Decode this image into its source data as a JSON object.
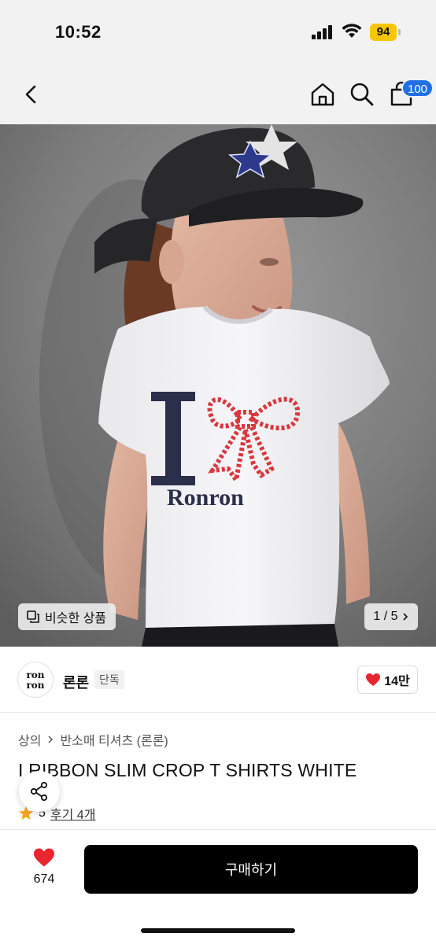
{
  "status_bar": {
    "time": "10:52",
    "battery": "94",
    "icons": [
      "signal-icon",
      "wifi-icon",
      "battery-icon"
    ]
  },
  "nav": {
    "icons": [
      "back-icon",
      "home-icon",
      "search-icon",
      "cart-icon"
    ],
    "cart_badge": "100"
  },
  "hero": {
    "similar_label": "비슷한 상품",
    "pager": "1 / 5",
    "shirt_print": {
      "letter": "I",
      "word": "Ronron"
    }
  },
  "brand": {
    "logo_lines": [
      "ron",
      "ron"
    ],
    "name": "론론",
    "tag": "단독",
    "likes": "14만"
  },
  "product": {
    "breadcrumb": [
      "상의",
      "반소매 티셔츠 (론론)"
    ],
    "title": "I RIBBON SLIM CROP T SHIRTS WHITE",
    "rating": "5",
    "reviews": "후기 4개"
  },
  "bottom_bar": {
    "wish_count": "674",
    "buy_label": "구매하기"
  },
  "colors": {
    "accent_blue": "#1f6fe5",
    "heart_red": "#e8262e",
    "star_yellow": "#f5a623",
    "battery_yellow": "#f7c600"
  }
}
